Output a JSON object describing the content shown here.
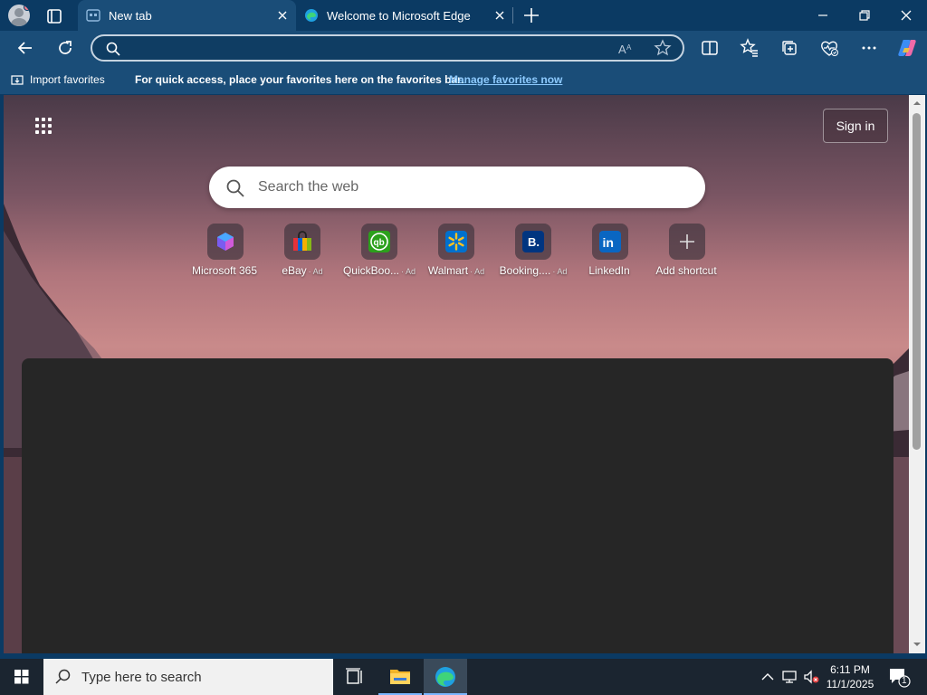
{
  "tabs": [
    {
      "title": "New tab",
      "active": true,
      "icon": "newtab-icon"
    },
    {
      "title": "Welcome to Microsoft Edge",
      "active": false,
      "icon": "edge-icon"
    }
  ],
  "address_bar": {
    "value": "",
    "placeholder": ""
  },
  "favorites_bar": {
    "import_label": "Import favorites",
    "message": "For quick access, place your favorites here on the favorites bar.",
    "manage_link": "Manage favorites now"
  },
  "page": {
    "sign_in_label": "Sign in",
    "search_placeholder": "Search the web",
    "shortcuts": [
      {
        "label": "Microsoft 365",
        "ad": "",
        "icon": "microsoft-365-icon"
      },
      {
        "label": "eBay",
        "ad": "Ad",
        "icon": "ebay-icon"
      },
      {
        "label": "QuickBoo...",
        "ad": "Ad",
        "icon": "quickbooks-icon"
      },
      {
        "label": "Walmart",
        "ad": "Ad",
        "icon": "walmart-icon"
      },
      {
        "label": "Booking....",
        "ad": "Ad",
        "icon": "booking-icon"
      },
      {
        "label": "LinkedIn",
        "ad": "",
        "icon": "linkedin-icon"
      },
      {
        "label": "Add shortcut",
        "ad": "",
        "icon": "plus-icon"
      }
    ]
  },
  "taskbar": {
    "search_placeholder": "Type here to search",
    "time": "6:11 PM",
    "date": "11/1/2025",
    "notification_count": "1"
  },
  "colors": {
    "tab_strip": "#0b3a63",
    "toolbar": "#1a4d78",
    "link": "#8ecbff",
    "feed": "#262626",
    "taskbar": "#1b2530"
  }
}
